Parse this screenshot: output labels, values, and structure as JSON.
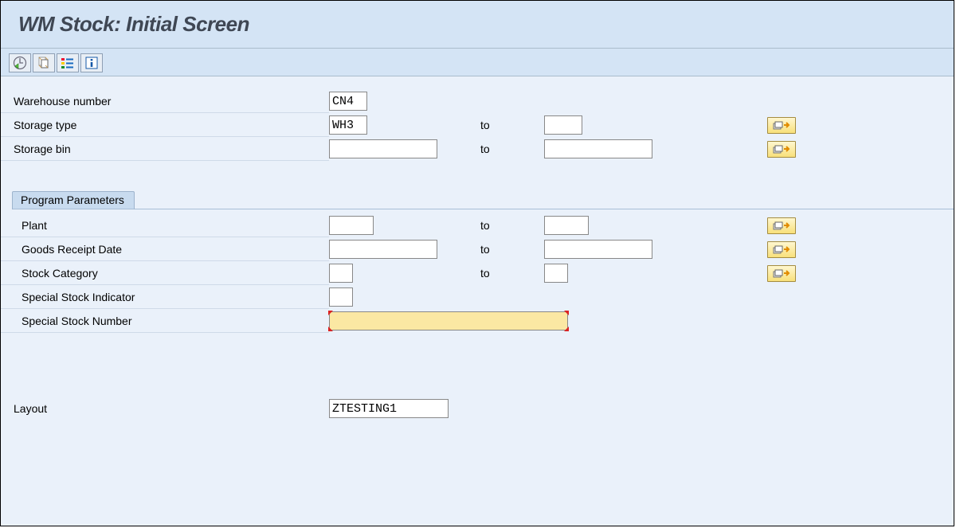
{
  "title": "WM Stock: Initial Screen",
  "labels": {
    "warehouse_number": "Warehouse number",
    "storage_type": "Storage type",
    "storage_bin": "Storage bin",
    "program_parameters": "Program Parameters",
    "plant": "Plant",
    "goods_receipt_date": "Goods Receipt Date",
    "stock_category": "Stock Category",
    "special_stock_indicator": "Special Stock Indicator",
    "special_stock_number": "Special Stock Number",
    "layout": "Layout",
    "to": "to"
  },
  "values": {
    "warehouse_number": "CN4",
    "storage_type_from": "WH3",
    "storage_type_to": "",
    "storage_bin_from": "",
    "storage_bin_to": "",
    "plant_from": "",
    "plant_to": "",
    "gr_date_from": "",
    "gr_date_to": "",
    "stock_category_from": "",
    "stock_category_to": "",
    "special_stock_indicator": "",
    "special_stock_number": "",
    "layout": "ZTESTING1"
  }
}
